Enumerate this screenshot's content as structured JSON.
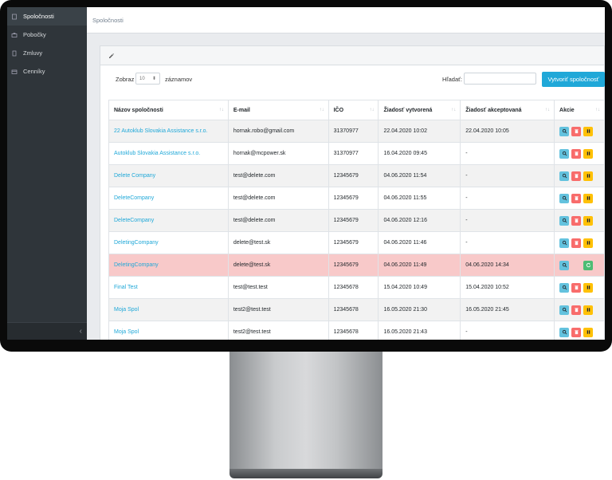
{
  "sidebar": {
    "items": [
      {
        "label": "Spoločnosti",
        "icon": "building-icon",
        "active": true
      },
      {
        "label": "Pobočky",
        "icon": "briefcase-icon",
        "active": false
      },
      {
        "label": "Zmluvy",
        "icon": "document-icon",
        "active": false
      },
      {
        "label": "Cenníky",
        "icon": "price-icon",
        "active": false
      }
    ],
    "collapse_glyph": "‹"
  },
  "breadcrumb": "Spoločnosti",
  "controls": {
    "show_prefix": "Zobraz",
    "show_value": "10",
    "show_suffix": "záznamov",
    "search_label": "Hľadať:",
    "search_value": "",
    "create_button": "Vytvoriť spoločnosť"
  },
  "table": {
    "headers": [
      "Názov spoločnosti",
      "E-mail",
      "IČO",
      "Žiadosť vytvorená",
      "Žiadosť akceptovaná",
      "Akcie"
    ],
    "rows": [
      {
        "name": "22 Autoklub Slovakia Assistance s.r.o.",
        "email": "hornak.robo@gmail.com",
        "ico": "31370977",
        "created": "22.04.2020 10:02",
        "accepted": "22.04.2020 10:05",
        "state": "normal"
      },
      {
        "name": "Autoklub Slovakia Assistance s.r.o.",
        "email": "hornak@mcpower.sk",
        "ico": "31370977",
        "created": "16.04.2020 09:45",
        "accepted": "-",
        "state": "normal"
      },
      {
        "name": "Delete Company",
        "email": "test@delete.com",
        "ico": "12345679",
        "created": "04.06.2020 11:54",
        "accepted": "-",
        "state": "normal"
      },
      {
        "name": "DeleteCompany",
        "email": "test@delete.com",
        "ico": "12345679",
        "created": "04.06.2020 11:55",
        "accepted": "-",
        "state": "normal"
      },
      {
        "name": "DeleteCompany",
        "email": "test@delete.com",
        "ico": "12345679",
        "created": "04.06.2020 12:16",
        "accepted": "-",
        "state": "normal"
      },
      {
        "name": "DeletingCompany",
        "email": "delete@test.sk",
        "ico": "12345679",
        "created": "04.06.2020 11:46",
        "accepted": "-",
        "state": "normal"
      },
      {
        "name": "DeletingCompany",
        "email": "delete@test.sk",
        "ico": "12345679",
        "created": "04.06.2020 11:49",
        "accepted": "04.06.2020 14:34",
        "state": "deleted"
      },
      {
        "name": "Final Test",
        "email": "test@test.test",
        "ico": "12345678",
        "created": "15.04.2020 10:49",
        "accepted": "15.04.2020 10:52",
        "state": "normal"
      },
      {
        "name": "Moja Spol",
        "email": "test2@test.test",
        "ico": "12345678",
        "created": "16.05.2020 21:30",
        "accepted": "16.05.2020 21:45",
        "state": "normal"
      },
      {
        "name": "Moja Spol",
        "email": "test2@test.test",
        "ico": "12345678",
        "created": "16.05.2020 21:43",
        "accepted": "-",
        "state": "normal"
      }
    ]
  },
  "colors": {
    "accent": "#20a8d8",
    "sidebar_bg": "#2f353a",
    "danger_row": "#f8c9c9",
    "btn_view": "#63c2de",
    "btn_delete": "#f86c6b",
    "btn_pause": "#ffc107",
    "btn_restore": "#4dbd74"
  }
}
